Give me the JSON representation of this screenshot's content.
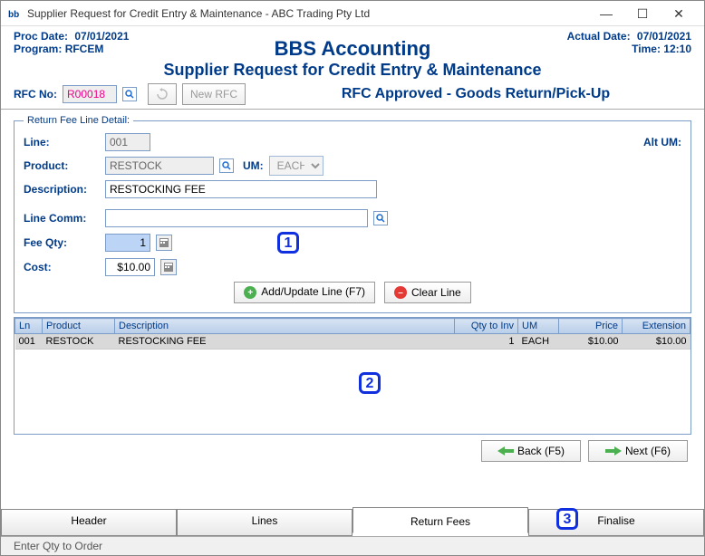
{
  "window": {
    "title": "Supplier Request for Credit Entry & Maintenance - ABC Trading Pty Ltd"
  },
  "header": {
    "proc_date_label": "Proc Date:",
    "proc_date": "07/01/2021",
    "program_label": "Program:",
    "program": "RFCEM",
    "title_big": "BBS Accounting",
    "title_sub": "Supplier Request for Credit Entry & Maintenance",
    "actual_date_label": "Actual Date:",
    "actual_date": "07/01/2021",
    "time_label": "Time:",
    "time": "12:10"
  },
  "rfc": {
    "label": "RFC No:",
    "value": "R00018",
    "new_btn": "New RFC",
    "status": "RFC Approved - Goods Return/Pick-Up"
  },
  "detail": {
    "legend": "Return Fee Line Detail:",
    "line_label": "Line:",
    "line": "001",
    "product_label": "Product:",
    "product": "RESTOCK",
    "um_label": "UM:",
    "um": "EACH",
    "alt_um_label": "Alt UM:",
    "desc_label": "Description:",
    "desc": "RESTOCKING FEE",
    "linecomm_label": "Line Comm:",
    "linecomm": "",
    "feeqty_label": "Fee Qty:",
    "feeqty": "1",
    "cost_label": "Cost:",
    "cost": "$10.00",
    "add_btn": "Add/Update Line (F7)",
    "clear_btn": "Clear Line"
  },
  "grid": {
    "headers": {
      "ln": "Ln",
      "product": "Product",
      "description": "Description",
      "qty": "Qty to Inv",
      "um": "UM",
      "price": "Price",
      "ext": "Extension"
    },
    "rows": [
      {
        "ln": "001",
        "product": "RESTOCK",
        "description": "RESTOCKING FEE",
        "qty": "1",
        "um": "EACH",
        "price": "$10.00",
        "ext": "$10.00"
      }
    ]
  },
  "nav": {
    "back": "Back (F5)",
    "next": "Next (F6)"
  },
  "tabs": {
    "header": "Header",
    "lines": "Lines",
    "return_fees": "Return Fees",
    "finalise": "Finalise"
  },
  "statusbar": "Enter Qty to Order",
  "callouts": {
    "one": "1",
    "two": "2",
    "three": "3"
  }
}
